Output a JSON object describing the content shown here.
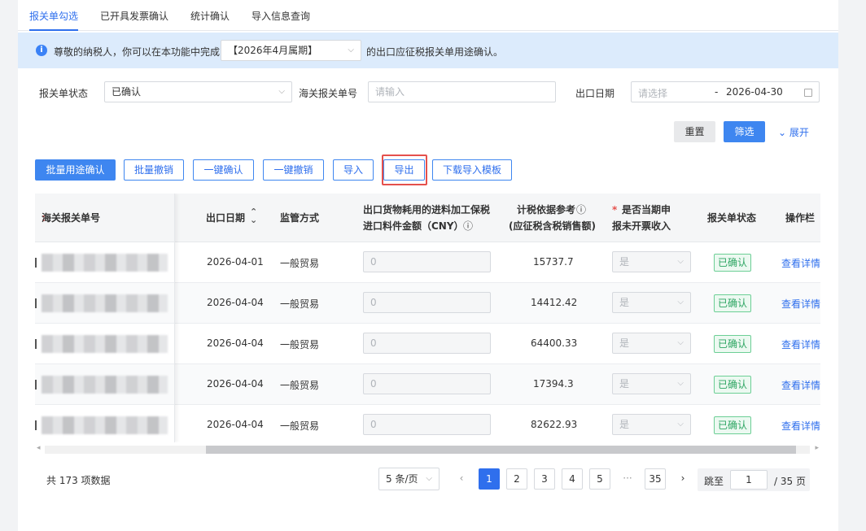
{
  "tabs": [
    "报关单勾选",
    "已开具发票确认",
    "统计确认",
    "导入信息查询"
  ],
  "notice": {
    "text_before": "尊敬的纳税人，你可以在本功能中完成",
    "period": "【2026年4月属期】",
    "text_after": "的出口应征税报关单用途确认。"
  },
  "filters": {
    "status_label": "报关单状态",
    "status_value": "已确认",
    "customs_no_label": "海关报关单号",
    "customs_no_placeholder": "请输入",
    "export_date_label": "出口日期",
    "date_start_placeholder": "请选择",
    "date_separator": "-",
    "date_end": "2026-04-30",
    "reset_label": "重置",
    "filter_label": "筛选",
    "expand_label": "展开"
  },
  "toolbar": {
    "batch_confirm": "批量用途确认",
    "batch_revoke": "批量撤销",
    "one_click_confirm": "一键确认",
    "one_click_revoke": "一键撤销",
    "import": "导入",
    "export": "导出",
    "download_template": "下载导入模板"
  },
  "table": {
    "headers": {
      "customs_no": "海关报关单号",
      "export_date": "出口日期",
      "supervision": "监管方式",
      "amount_line1": "出口货物耗用的进料加工保税",
      "amount_line2": "进口料件金额（CNY）",
      "tax_basis_line1": "计税依据参考",
      "tax_basis_line2": "(应征税含税销售额)",
      "unbilled_required_mark": "*",
      "unbilled_line1": "是否当期申",
      "unbilled_line2": "报未开票收入",
      "status": "报关单状态",
      "actions": "操作栏"
    },
    "rows": [
      {
        "date": "2026-04-01",
        "method": "一般贸易",
        "amount": "0",
        "tax_basis": "15737.7",
        "unbilled": "是",
        "status": "已确认",
        "action": "查看详情"
      },
      {
        "date": "2026-04-04",
        "method": "一般贸易",
        "amount": "0",
        "tax_basis": "14412.42",
        "unbilled": "是",
        "status": "已确认",
        "action": "查看详情"
      },
      {
        "date": "2026-04-04",
        "method": "一般贸易",
        "amount": "0",
        "tax_basis": "64400.33",
        "unbilled": "是",
        "status": "已确认",
        "action": "查看详情"
      },
      {
        "date": "2026-04-04",
        "method": "一般贸易",
        "amount": "0",
        "tax_basis": "17394.3",
        "unbilled": "是",
        "status": "已确认",
        "action": "查看详情"
      },
      {
        "date": "2026-04-04",
        "method": "一般贸易",
        "amount": "0",
        "tax_basis": "82622.93",
        "unbilled": "是",
        "status": "已确认",
        "action": "查看详情"
      }
    ]
  },
  "pagination": {
    "total": "共 173 项数据",
    "page_size": "5 条/页",
    "prev": "‹",
    "pages": [
      "1",
      "2",
      "3",
      "4",
      "5"
    ],
    "ellipsis": "···",
    "last_page": "35",
    "next": "›",
    "jump_label": "跳至",
    "jump_value": "1",
    "total_pages": "/ 35 页"
  },
  "colors": {
    "primary": "#2f6fed",
    "highlight": "#e5504c",
    "success": "#2da562"
  }
}
